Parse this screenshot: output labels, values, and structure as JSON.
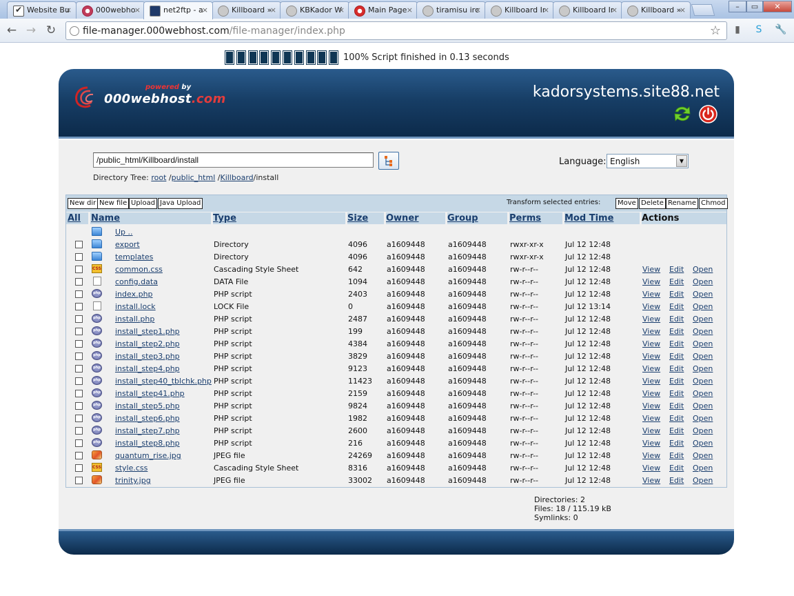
{
  "browser": {
    "tabs": [
      {
        "label": "Website Bu",
        "icon": "checkbox-icon"
      },
      {
        "label": "000webho",
        "icon": "swirl-icon"
      },
      {
        "label": "net2ftp - a",
        "icon": "arrow-icon"
      },
      {
        "label": "Killboard »",
        "icon": "globe-icon"
      },
      {
        "label": "KBKador W",
        "icon": "globe-icon"
      },
      {
        "label": "Main Page",
        "icon": "gear-red-icon"
      },
      {
        "label": "tiramisu irc",
        "icon": "globe-icon"
      },
      {
        "label": "Killboard Ir",
        "icon": "globe-icon"
      },
      {
        "label": "Killboard Ir",
        "icon": "globe-icon"
      },
      {
        "label": "Killboard »",
        "icon": "globe-icon"
      }
    ],
    "url_host": "file-manager.000webhost.com",
    "url_path": "/file-manager/index.php"
  },
  "progress": {
    "percent": 100,
    "text": "100% Script finished in 0.13 seconds"
  },
  "header": {
    "powered_by": "powered",
    "by": "by",
    "logo_main": "000webhost",
    "logo_tld": ".com",
    "site": "kadorsystems.site88.net"
  },
  "nav": {
    "path_value": "/public_html/Killboard/install",
    "tree_label": "Directory Tree:",
    "tree": [
      {
        "text": "root",
        "link": true
      },
      {
        "text": "/",
        "link": false
      },
      {
        "text": "public_html",
        "link": true
      },
      {
        "text": "/",
        "link": false
      },
      {
        "text": "Killboard",
        "link": true
      },
      {
        "text": "/install",
        "link": false
      }
    ],
    "language_label": "Language:",
    "language_value": "English"
  },
  "actions": {
    "left": [
      "New dir",
      "New file",
      "Upload",
      "Java Upload"
    ],
    "transform_label": "Transform selected entries:",
    "right": [
      "Move",
      "Delete",
      "Rename",
      "Chmod"
    ]
  },
  "columns": {
    "all": "All",
    "name": "Name",
    "type": "Type",
    "size": "Size",
    "owner": "Owner",
    "group": "Group",
    "perms": "Perms",
    "mtime": "Mod Time",
    "actions": "Actions"
  },
  "row_actions": {
    "view": "View",
    "edit": "Edit",
    "open": "Open"
  },
  "up_label": "Up ..",
  "entries": [
    {
      "name": "export",
      "type": "Directory",
      "size": "4096",
      "owner": "a1609448",
      "group": "a1609448",
      "perms": "rwxr-xr-x",
      "mtime": "Jul 12 12:48",
      "icon": "folder"
    },
    {
      "name": "templates",
      "type": "Directory",
      "size": "4096",
      "owner": "a1609448",
      "group": "a1609448",
      "perms": "rwxr-xr-x",
      "mtime": "Jul 12 12:48",
      "icon": "folder"
    },
    {
      "name": "common.css",
      "type": "Cascading Style Sheet",
      "size": "642",
      "owner": "a1609448",
      "group": "a1609448",
      "perms": "rw-r--r--",
      "mtime": "Jul 12 12:48",
      "icon": "css"
    },
    {
      "name": "config.data",
      "type": "DATA File",
      "size": "1094",
      "owner": "a1609448",
      "group": "a1609448",
      "perms": "rw-r--r--",
      "mtime": "Jul 12 12:48",
      "icon": "file"
    },
    {
      "name": "index.php",
      "type": "PHP script",
      "size": "2403",
      "owner": "a1609448",
      "group": "a1609448",
      "perms": "rw-r--r--",
      "mtime": "Jul 12 12:48",
      "icon": "php"
    },
    {
      "name": "install.lock",
      "type": "LOCK File",
      "size": "0",
      "owner": "a1609448",
      "group": "a1609448",
      "perms": "rw-r--r--",
      "mtime": "Jul 12 13:14",
      "icon": "file"
    },
    {
      "name": "install.php",
      "type": "PHP script",
      "size": "2487",
      "owner": "a1609448",
      "group": "a1609448",
      "perms": "rw-r--r--",
      "mtime": "Jul 12 12:48",
      "icon": "php"
    },
    {
      "name": "install_step1.php",
      "type": "PHP script",
      "size": "199",
      "owner": "a1609448",
      "group": "a1609448",
      "perms": "rw-r--r--",
      "mtime": "Jul 12 12:48",
      "icon": "php"
    },
    {
      "name": "install_step2.php",
      "type": "PHP script",
      "size": "4384",
      "owner": "a1609448",
      "group": "a1609448",
      "perms": "rw-r--r--",
      "mtime": "Jul 12 12:48",
      "icon": "php"
    },
    {
      "name": "install_step3.php",
      "type": "PHP script",
      "size": "3829",
      "owner": "a1609448",
      "group": "a1609448",
      "perms": "rw-r--r--",
      "mtime": "Jul 12 12:48",
      "icon": "php"
    },
    {
      "name": "install_step4.php",
      "type": "PHP script",
      "size": "9123",
      "owner": "a1609448",
      "group": "a1609448",
      "perms": "rw-r--r--",
      "mtime": "Jul 12 12:48",
      "icon": "php"
    },
    {
      "name": "install_step40_tblchk.php",
      "type": "PHP script",
      "size": "11423",
      "owner": "a1609448",
      "group": "a1609448",
      "perms": "rw-r--r--",
      "mtime": "Jul 12 12:48",
      "icon": "php"
    },
    {
      "name": "install_step41.php",
      "type": "PHP script",
      "size": "2159",
      "owner": "a1609448",
      "group": "a1609448",
      "perms": "rw-r--r--",
      "mtime": "Jul 12 12:48",
      "icon": "php"
    },
    {
      "name": "install_step5.php",
      "type": "PHP script",
      "size": "9824",
      "owner": "a1609448",
      "group": "a1609448",
      "perms": "rw-r--r--",
      "mtime": "Jul 12 12:48",
      "icon": "php"
    },
    {
      "name": "install_step6.php",
      "type": "PHP script",
      "size": "1982",
      "owner": "a1609448",
      "group": "a1609448",
      "perms": "rw-r--r--",
      "mtime": "Jul 12 12:48",
      "icon": "php"
    },
    {
      "name": "install_step7.php",
      "type": "PHP script",
      "size": "2600",
      "owner": "a1609448",
      "group": "a1609448",
      "perms": "rw-r--r--",
      "mtime": "Jul 12 12:48",
      "icon": "php"
    },
    {
      "name": "install_step8.php",
      "type": "PHP script",
      "size": "216",
      "owner": "a1609448",
      "group": "a1609448",
      "perms": "rw-r--r--",
      "mtime": "Jul 12 12:48",
      "icon": "php"
    },
    {
      "name": "quantum_rise.jpg",
      "type": "JPEG file",
      "size": "24269",
      "owner": "a1609448",
      "group": "a1609448",
      "perms": "rw-r--r--",
      "mtime": "Jul 12 12:48",
      "icon": "jpg"
    },
    {
      "name": "style.css",
      "type": "Cascading Style Sheet",
      "size": "8316",
      "owner": "a1609448",
      "group": "a1609448",
      "perms": "rw-r--r--",
      "mtime": "Jul 12 12:48",
      "icon": "css"
    },
    {
      "name": "trinity.jpg",
      "type": "JPEG file",
      "size": "33002",
      "owner": "a1609448",
      "group": "a1609448",
      "perms": "rw-r--r--",
      "mtime": "Jul 12 12:48",
      "icon": "jpg"
    }
  ],
  "summary": {
    "directories": "Directories: 2",
    "files": "Files: 18 / 115.19 kB",
    "symlinks": "Symlinks: 0"
  },
  "colors": {
    "header_dark": "#0c2a4a",
    "header_light": "#2a5b8c",
    "link": "#1a3e6e",
    "bar_bg": "#c6d8e6"
  }
}
